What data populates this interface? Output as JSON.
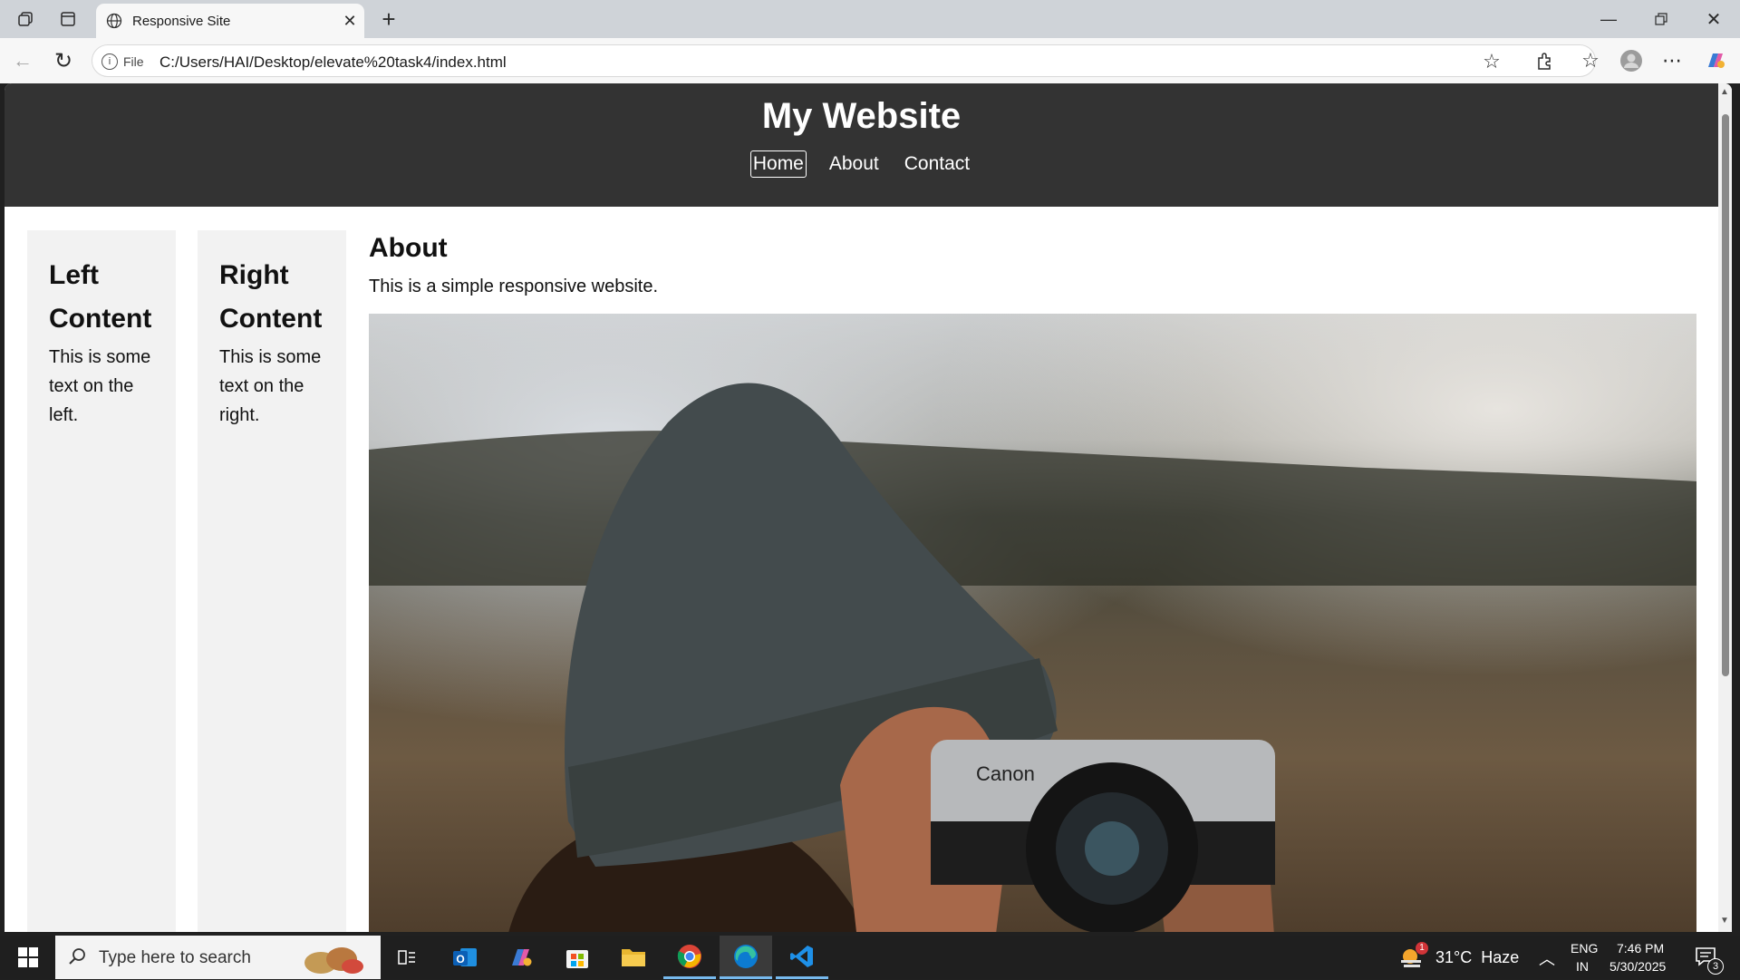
{
  "browser": {
    "tab_title": "Responsive Site",
    "file_label": "File",
    "url": "C:/Users/HAI/Desktop/elevate%20task4/index.html"
  },
  "page": {
    "site_title": "My Website",
    "nav": [
      "Home",
      "About",
      "Contact"
    ],
    "left": {
      "heading": "Left Content",
      "text": "This is some text on the left."
    },
    "right": {
      "heading": "Right Content",
      "text": "This is some text on the right."
    },
    "main": {
      "heading": "About",
      "text": "This is a simple responsive website."
    },
    "camera_brand": "Canon"
  },
  "taskbar": {
    "search_placeholder": "Type here to search",
    "weather": "31°C  Haze",
    "weather_badge": "1",
    "lang_top": "ENG",
    "lang_bottom": "IN",
    "time": "7:46 PM",
    "date": "5/30/2025",
    "notification_count": "3"
  }
}
